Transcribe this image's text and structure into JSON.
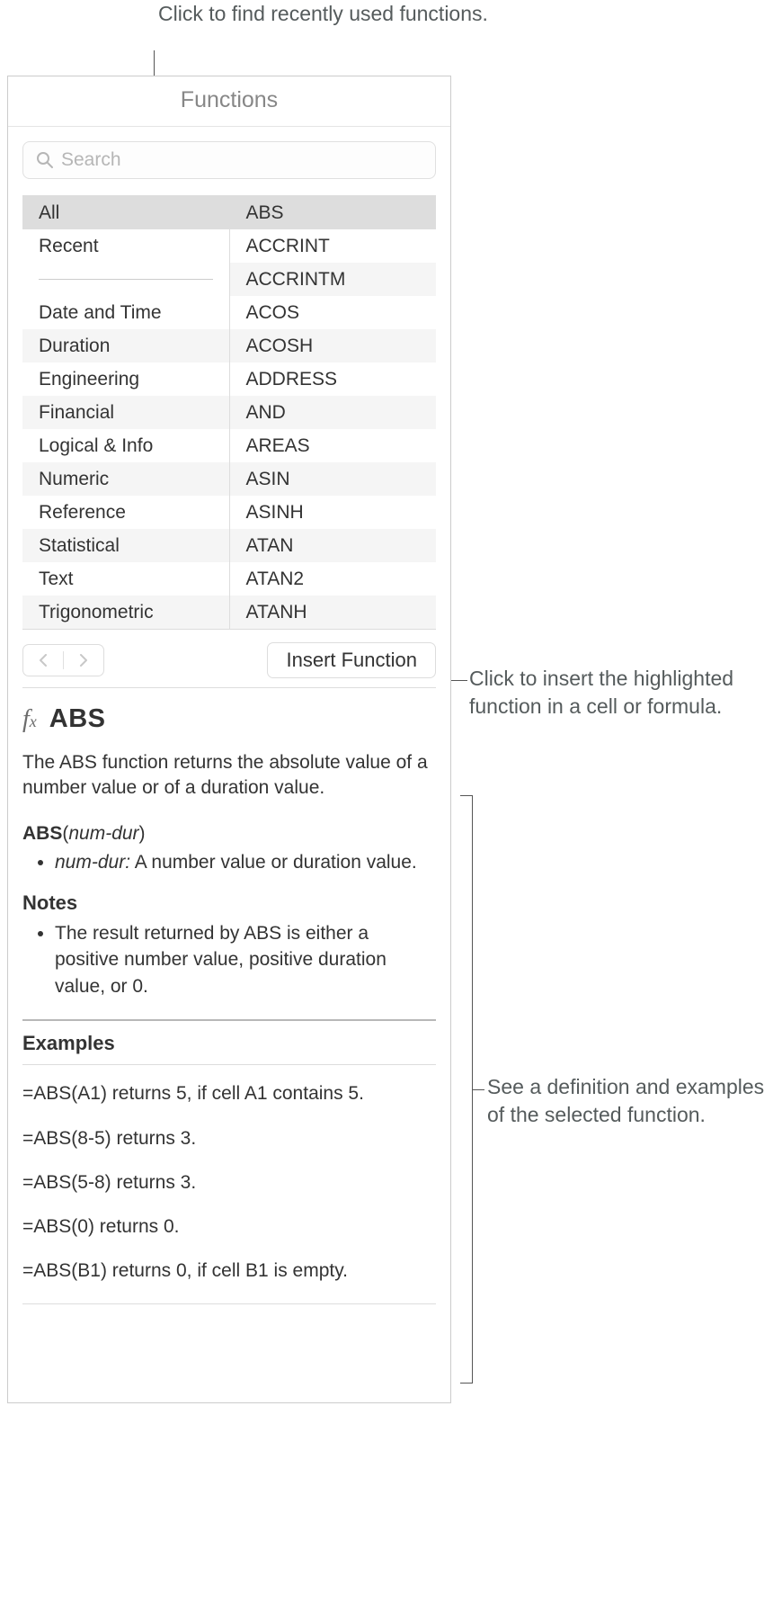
{
  "callouts": {
    "top": "Click to find recently used functions.",
    "insert": "Click to insert the highlighted function in a cell or formula.",
    "detail": "See a definition and examples of the selected function."
  },
  "panel": {
    "title": "Functions",
    "search_placeholder": "Search",
    "categories": [
      "All",
      "Recent",
      "Date and Time",
      "Duration",
      "Engineering",
      "Financial",
      "Logical & Info",
      "Numeric",
      "Reference",
      "Statistical",
      "Text",
      "Trigonometric"
    ],
    "functions": [
      "ABS",
      "ACCRINT",
      "ACCRINTM",
      "ACOS",
      "ACOSH",
      "ADDRESS",
      "AND",
      "AREAS",
      "ASIN",
      "ASINH",
      "ATAN",
      "ATAN2",
      "ATANH"
    ],
    "insert_label": "Insert Function"
  },
  "detail": {
    "fn_name": "ABS",
    "description": "The ABS function returns the absolute value of a number value or of a duration value.",
    "sig_name": "ABS",
    "sig_arg": "num-dur",
    "param_name": "num-dur:",
    "param_desc": "A number value or duration value.",
    "notes_heading": "Notes",
    "note1": "The result returned by ABS is either a positive number value, positive duration value, or 0.",
    "examples_heading": "Examples",
    "ex1": "=ABS(A1) returns 5, if cell A1 contains 5.",
    "ex2": "=ABS(8-5) returns 3.",
    "ex3": "=ABS(5-8) returns 3.",
    "ex4": "=ABS(0) returns 0.",
    "ex5": "=ABS(B1) returns 0, if cell B1 is empty."
  }
}
